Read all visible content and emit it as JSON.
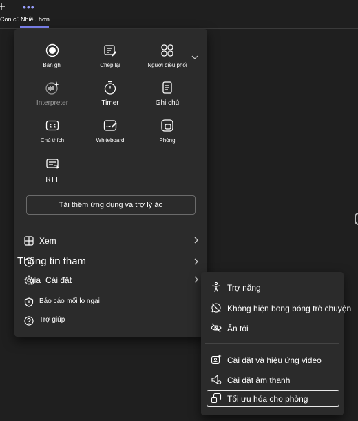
{
  "topbar": {
    "items": [
      {
        "label": "Con cú",
        "icon": "plus-icon"
      },
      {
        "label": "Nhiều hơn",
        "icon": "more-dots-icon"
      }
    ]
  },
  "more_menu": {
    "apps": [
      {
        "label": "Bản ghi",
        "icon": "record-icon"
      },
      {
        "label": "Chép lại",
        "icon": "transcript-icon"
      },
      {
        "label": "Người điều phối",
        "icon": "facilitator-icon"
      },
      {
        "label": "Interpreter",
        "icon": "interpreter-icon"
      },
      {
        "label": "Timer",
        "icon": "timer-icon"
      },
      {
        "label": "Ghi chú",
        "icon": "notes-icon"
      },
      {
        "label": "Chú thích",
        "icon": "captions-icon"
      },
      {
        "label": "Whiteboard",
        "icon": "whiteboard-icon"
      },
      {
        "label": "Phòng",
        "icon": "rooms-icon"
      },
      {
        "label": "RTT",
        "icon": "rtt-icon"
      }
    ],
    "get_more_label": "Tải thêm ứng dụng và trợ lý ảo",
    "rows": [
      {
        "label": "Xem",
        "icon": "view-grid-icon"
      },
      {
        "label": "Thông tin tham gia",
        "icon": "info-icon"
      },
      {
        "label": "Cài đặt",
        "icon": "settings-gear-icon"
      },
      {
        "label": "Báo cáo mối lo ngại",
        "icon": "report-shield-icon"
      },
      {
        "label": "Trợ giúp",
        "icon": "help-icon"
      }
    ],
    "overlap_fragments": {
      "thong_tin": "Thông tin tham",
      "gia": "gia"
    }
  },
  "settings_submenu": {
    "items": [
      {
        "label": "Trợ năng",
        "icon": "accessibility-icon"
      },
      {
        "label": "Không hiện bong bóng trò chuyện",
        "icon": "chat-bubble-off-icon"
      },
      {
        "label": "Ẩn tôi",
        "icon": "hide-me-icon"
      },
      {
        "label": "Cài đặt và hiệu ứng video",
        "icon": "video-effects-icon"
      },
      {
        "label": "Cài đặt âm thanh",
        "icon": "speaker-icon"
      },
      {
        "label": "Tối ưu hóa cho phòng",
        "icon": "optimize-room-icon"
      }
    ]
  },
  "colors": {
    "accent": "#7f85f5",
    "menu_bg": "#2b2b2b",
    "page_bg": "#1f1f1f"
  }
}
